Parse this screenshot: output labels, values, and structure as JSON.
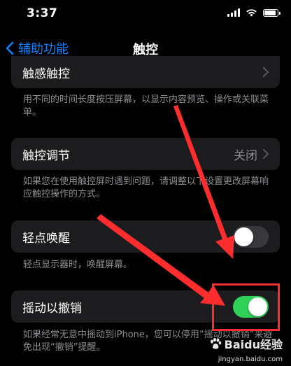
{
  "status_bar": {
    "time": "3:37"
  },
  "nav": {
    "back_label": "辅助功能",
    "title": "触控"
  },
  "sections": {
    "haptic_touch": {
      "label": "触感触控",
      "footer": "用不同的时间长度按压屏幕，以显示内容预览、操作或关联菜单。"
    },
    "touch_accommodations": {
      "label": "触控调节",
      "value": "关闭",
      "footer": "如果您在使用触控屏时遇到问题，请调整以下设置更改屏幕响应触控操作的方式。"
    },
    "tap_to_wake": {
      "label": "轻点唤醒",
      "enabled": false,
      "footer": "轻点显示器时，唤醒屏幕。"
    },
    "shake_to_undo": {
      "label": "摇动以撤销",
      "enabled": true,
      "footer": "如果经常无意中摇动到iPhone，您可以停用“摇动以撤销”来避免出现“撤销”提醒。"
    }
  },
  "watermark": {
    "brand": "Baidu经验",
    "url": "jingyan.baidu.com"
  },
  "colors": {
    "accent": "#0a84ff",
    "toggle_on": "#30d158",
    "toggle_off": "#39393d",
    "annotation": "#ff2d2d"
  }
}
